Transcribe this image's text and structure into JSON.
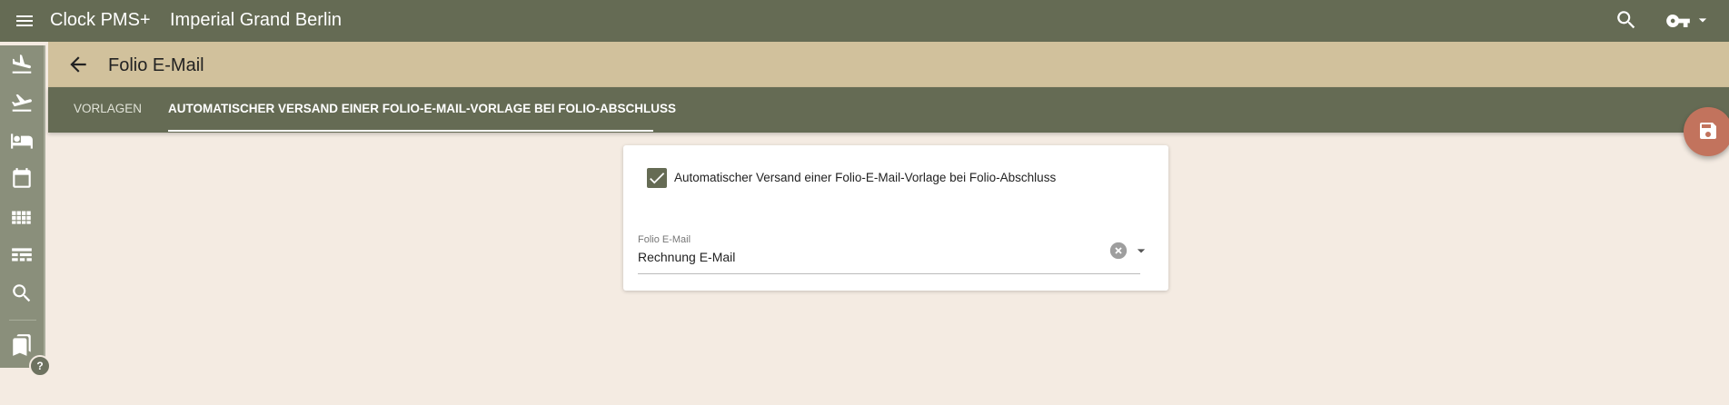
{
  "header": {
    "app_title": "Clock PMS+",
    "hotel_name": "Imperial Grand Berlin",
    "icons": [
      "menu-icon",
      "search-icon",
      "key-icon",
      "caret-down-icon"
    ]
  },
  "sidebar": {
    "items": [
      {
        "name": "arrivals",
        "icon": "flight-land-icon"
      },
      {
        "name": "departures",
        "icon": "flight-takeoff-icon"
      },
      {
        "name": "rooms",
        "icon": "bed-icon"
      },
      {
        "name": "calendar",
        "icon": "calendar-icon"
      },
      {
        "name": "grid",
        "icon": "grid-icon"
      },
      {
        "name": "reports",
        "icon": "table-icon"
      },
      {
        "name": "search",
        "icon": "search-icon"
      },
      {
        "name": "bookmarks",
        "icon": "bookmarks-icon"
      }
    ],
    "help_label": "?"
  },
  "page": {
    "title": "Folio E-Mail"
  },
  "tabs": [
    {
      "label": "VORLAGEN",
      "active": false
    },
    {
      "label": "AUTOMATISCHER VERSAND EINER FOLIO-E-MAIL-VORLAGE BEI FOLIO-ABSCHLUSS",
      "active": true
    }
  ],
  "form": {
    "checkbox_label": "Automatischer Versand einer Folio-E-Mail-Vorlage bei Folio-Abschluss",
    "checkbox_checked": true,
    "select_label": "Folio E-Mail",
    "select_value": "Rechnung E-Mail"
  },
  "colors": {
    "primary": "#656b54",
    "page_header": "#d1c19c",
    "background": "#f4ebe2",
    "fab": "#c2735d"
  }
}
